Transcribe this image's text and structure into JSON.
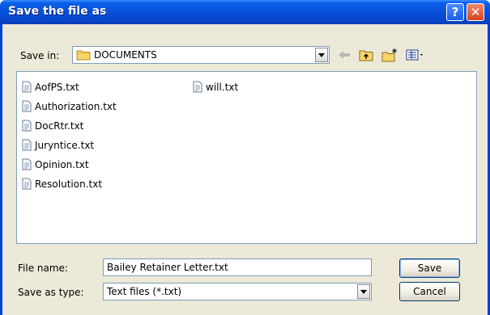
{
  "window": {
    "title": "Save the file as",
    "help_glyph": "?",
    "close_glyph": "✕"
  },
  "toolbar": {
    "save_in_label": "Save in:",
    "save_in_value": "DOCUMENTS",
    "icons": [
      "back-arrow-icon",
      "up-one-level-icon",
      "create-new-folder-icon",
      "views-menu-icon"
    ]
  },
  "files": [
    {
      "name": "AofPS.txt"
    },
    {
      "name": "Authorization.txt"
    },
    {
      "name": "DocRtr.txt"
    },
    {
      "name": "Juryntice.txt"
    },
    {
      "name": "Opinion.txt"
    },
    {
      "name": "Resolution.txt"
    },
    {
      "name": "will.txt"
    }
  ],
  "form": {
    "file_name_label": "File name:",
    "file_name_value": "Bailey Retainer Letter.txt",
    "save_as_type_label": "Save as type:",
    "save_as_type_value": "Text files (*.txt)"
  },
  "buttons": {
    "save": "Save",
    "cancel": "Cancel"
  },
  "colors": {
    "titlebar": "#0852db",
    "dialog_face": "#ece9d8",
    "close_button": "#d8411e"
  }
}
